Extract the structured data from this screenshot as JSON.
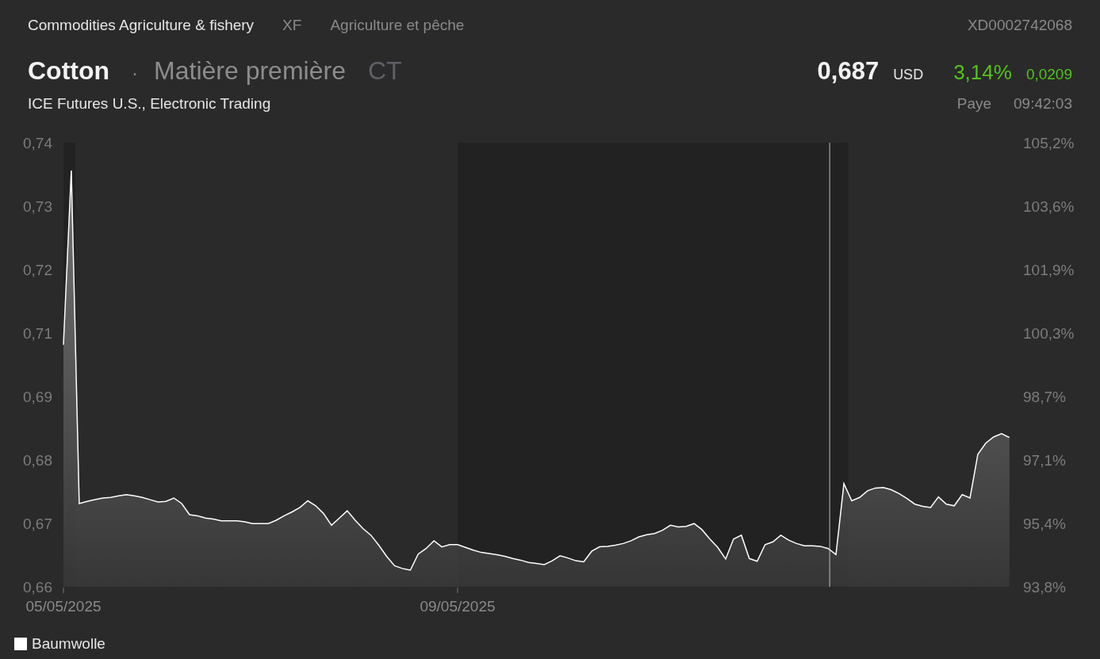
{
  "header": {
    "category": "Commodities Agriculture & fishery",
    "code": "XF",
    "category_local": "Agriculture et pêche",
    "isin": "XD0002742068"
  },
  "title": {
    "name": "Cotton",
    "separator": "·",
    "type": "Matière première",
    "symbol": "CT",
    "exchange": "ICE Futures U.S., Electronic Trading"
  },
  "quote": {
    "price": "0,687",
    "currency": "USD",
    "change_percent": "3,14%",
    "change": "0,0209",
    "market": "Paye",
    "time": "09:42:03"
  },
  "chart": {
    "right_axis_labels": [
      "105,2%",
      "103,6%",
      "101,9%",
      "100,3%",
      "98,7%",
      "97,1%",
      "95,4%",
      "93,8%"
    ],
    "chart_data": {
      "type": "area",
      "ylim": [
        0.66,
        0.74
      ],
      "yticks": [
        {
          "value": 0.66,
          "label": "0,66"
        },
        {
          "value": 0.6714,
          "label": "0,67"
        },
        {
          "value": 0.6829,
          "label": "0,68"
        },
        {
          "value": 0.6943,
          "label": "0,69"
        },
        {
          "value": 0.7057,
          "label": "0,71"
        },
        {
          "value": 0.7171,
          "label": "0,72"
        },
        {
          "value": 0.7286,
          "label": "0,73"
        },
        {
          "value": 0.74,
          "label": "0,74"
        }
      ],
      "categories": [
        "05/05/2025",
        null,
        null,
        null,
        null,
        null,
        null,
        null,
        null,
        null,
        null,
        null,
        null,
        null,
        null,
        null,
        null,
        null,
        null,
        null,
        null,
        null,
        null,
        null,
        null,
        null,
        null,
        null,
        null,
        null,
        null,
        null,
        null,
        null,
        null,
        null,
        null,
        null,
        null,
        null,
        null,
        null,
        null,
        null,
        null,
        null,
        null,
        null,
        null,
        null,
        "09/05/2025",
        null,
        null,
        null,
        null,
        null,
        null,
        null,
        null,
        null,
        null,
        null,
        null,
        null,
        null,
        null,
        null,
        null,
        null,
        null,
        null,
        null,
        null,
        null,
        null,
        null,
        null,
        null,
        null,
        null,
        null,
        null,
        null,
        null,
        null,
        null,
        null,
        null,
        null,
        null,
        null,
        null,
        null,
        null,
        null,
        null,
        null,
        null,
        null,
        null,
        null,
        null,
        null,
        null,
        null,
        null,
        null,
        null,
        null,
        null,
        null,
        null,
        null,
        null,
        null,
        null,
        null,
        null,
        null,
        null,
        null
      ],
      "series": [
        {
          "name": "Baumwolle",
          "color": "#ffffff",
          "values": [
            0.7036,
            0.735,
            0.675,
            0.6754,
            0.6757,
            0.676,
            0.6761,
            0.6764,
            0.6766,
            0.6764,
            0.6761,
            0.6757,
            0.6753,
            0.6754,
            0.676,
            0.675,
            0.673,
            0.6728,
            0.6724,
            0.6722,
            0.6719,
            0.6719,
            0.6719,
            0.6717,
            0.6714,
            0.6714,
            0.6714,
            0.672,
            0.6728,
            0.6735,
            0.6743,
            0.6755,
            0.6746,
            0.6732,
            0.6711,
            0.6724,
            0.6737,
            0.672,
            0.6705,
            0.6693,
            0.6675,
            0.6655,
            0.6638,
            0.6633,
            0.663,
            0.6659,
            0.6669,
            0.6683,
            0.6672,
            0.6676,
            0.6676,
            0.6671,
            0.6666,
            0.6662,
            0.666,
            0.6658,
            0.6655,
            0.6651,
            0.6648,
            0.6644,
            0.6642,
            0.664,
            0.6647,
            0.6656,
            0.6652,
            0.6647,
            0.6645,
            0.6664,
            0.6672,
            0.6673,
            0.6675,
            0.6678,
            0.6683,
            0.669,
            0.6694,
            0.6696,
            0.6702,
            0.6711,
            0.6708,
            0.6709,
            0.6714,
            0.6703,
            0.6686,
            0.6671,
            0.665,
            0.6686,
            0.6693,
            0.6651,
            0.6646,
            0.6676,
            0.6681,
            0.6693,
            0.6684,
            0.6678,
            0.6674,
            0.6674,
            0.6673,
            0.6669,
            0.6658,
            0.6786,
            0.6755,
            0.6761,
            0.6773,
            0.6778,
            0.6779,
            0.6775,
            0.6768,
            0.6759,
            0.6749,
            0.6745,
            0.6743,
            0.6762,
            0.6749,
            0.6746,
            0.6766,
            0.676,
            0.6839,
            0.6859,
            0.687,
            0.6876,
            0.6869
          ]
        }
      ]
    }
  }
}
